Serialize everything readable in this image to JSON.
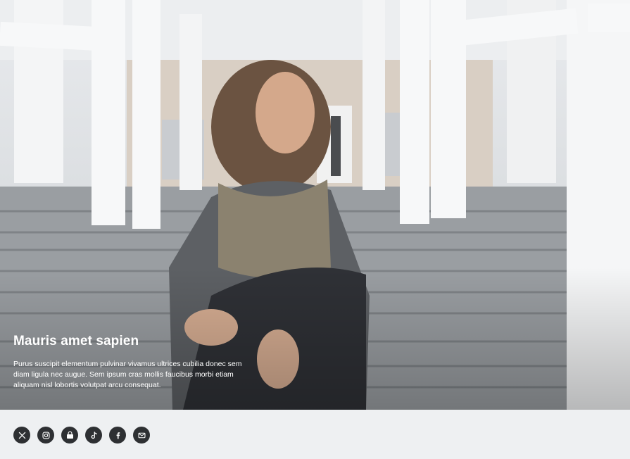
{
  "hero": {
    "title": "Mauris amet sapien",
    "body": "Purus suscipit elementum pulvinar vivamus ultrices cubilia donec sem diam ligula nec augue. Sem ipsum cras mollis faucibus morbi etiam aliquam nisl lobortis volutpat arcu consequat."
  },
  "social": {
    "icons": [
      "x-icon",
      "instagram-icon",
      "store-icon",
      "tiktok-icon",
      "facebook-icon",
      "mail-icon"
    ]
  }
}
